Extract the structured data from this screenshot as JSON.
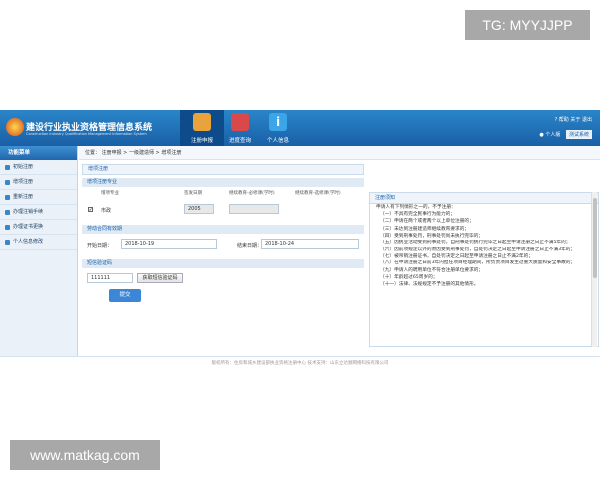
{
  "watermarks": {
    "top": "TG: MYYJJPP",
    "bottom": "www.matkag.com"
  },
  "header": {
    "title": "建设行业执业资格管理信息系统",
    "subtitle": "Construction Industry Qualification Management Information System",
    "nav": [
      {
        "label": "注册申报",
        "icon": "document-icon",
        "color": "#e8a43a",
        "active": true
      },
      {
        "label": "进度查询",
        "icon": "monitor-icon",
        "color": "#d9484a",
        "active": false
      },
      {
        "label": "个人信息",
        "icon": "info-icon",
        "color": "#3aa6e8",
        "active": false
      }
    ],
    "top_links": "? 帮助   关于   退出",
    "user_label": "个人版",
    "logout_label": "测试系统"
  },
  "sidebar": {
    "title": "功能菜单",
    "items": [
      "初始注册",
      "增项注册",
      "重新注册",
      "办理注销手续",
      "办理证书更换",
      "个人信息修改"
    ]
  },
  "breadcrumb": "位置：  注册申报  >  一级建造师  >  增项注册",
  "form": {
    "title": "增项注册",
    "section_major": "增项注册专业",
    "headers": [
      "增项专业",
      "签发日期",
      "继续教育-必修课(学时)",
      "继续教育-选修课(学时)"
    ],
    "row_major": "市政",
    "row_checked": "✔",
    "row_date": "2005",
    "section_exam": "劳动合同有效期",
    "start_label": "开始日期：",
    "start_value": "2018-10-19",
    "end_label": "结束日期：",
    "end_value": "2018-10-24",
    "section_code": "短信验证码",
    "code_value": "111111",
    "code_button": "获取短信验证码",
    "submit": "提交"
  },
  "notice": {
    "title": "注册须知",
    "lines": [
      "申请人有下列情形之一的，不予注册：",
      "（一）不具有完全民事行为能力的；",
      "（二）申请在两个或者两个以上单位注册的；",
      "（三）未达到注册建造师继续教育要求的；",
      "（四）受到刑事处罚，刑事处罚尚未执行完毕的；",
      "（五）因执业活动受到刑事处罚，自刑事处罚执行完毕之日起至申请注册之日止不满5年的；",
      "（六）因前项规定以外的原因受到刑事处罚，自处罚决定之日起至申请注册之日止不满3年的；",
      "（七）被吊销注册证书，自处罚决定之日起至申请注册之日止不满2年的；",
      "（八）在申请注册之日前3年内担任项目经理期间，所负责项目发生过重大质量和安全事故的；",
      "（九）申请人的聘用单位不符合注册单位要求的；",
      "（十）年龄超过65周岁的；",
      "（十一）法律、法规规定不予注册的其他情形。"
    ]
  },
  "footer": "版权所有：住房和城乡建设部执业资格注册中心    技术支持：山东立达顺网络科技有限公司"
}
